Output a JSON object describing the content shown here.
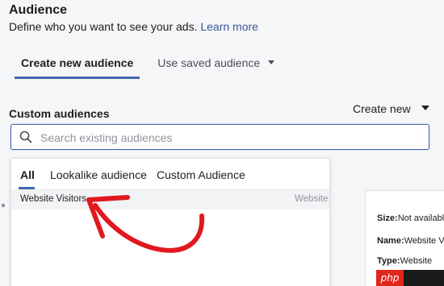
{
  "section": {
    "title": "Audience",
    "description": "Define who you want to see your ads.",
    "learn_more": "Learn more"
  },
  "tabs": [
    {
      "label": "Create new audience",
      "active": true
    },
    {
      "label": "Use saved audience",
      "active": false
    }
  ],
  "custom_audiences": {
    "label": "Custom audiences",
    "create_new": "Create new"
  },
  "search": {
    "placeholder": "Search existing audiences",
    "value": ""
  },
  "dropdown": {
    "tabs": [
      "All",
      "Lookalike audience",
      "Custom Audience"
    ],
    "active_tab": "All",
    "rows": [
      {
        "name": "Website Visitors",
        "type": "Website"
      }
    ]
  },
  "details": {
    "size_label": "Size:",
    "size_value": "Not available",
    "name_label": "Name:",
    "name_value": "Website Visitors",
    "type_label": "Type:",
    "type_value": "Website"
  },
  "watermark": {
    "text": "php"
  },
  "colors": {
    "accent": "#4267b2",
    "link": "#385898",
    "annotation_arrow": "#e0191f"
  },
  "icons": {
    "search": "search-icon",
    "caret": "caret-down-icon"
  }
}
